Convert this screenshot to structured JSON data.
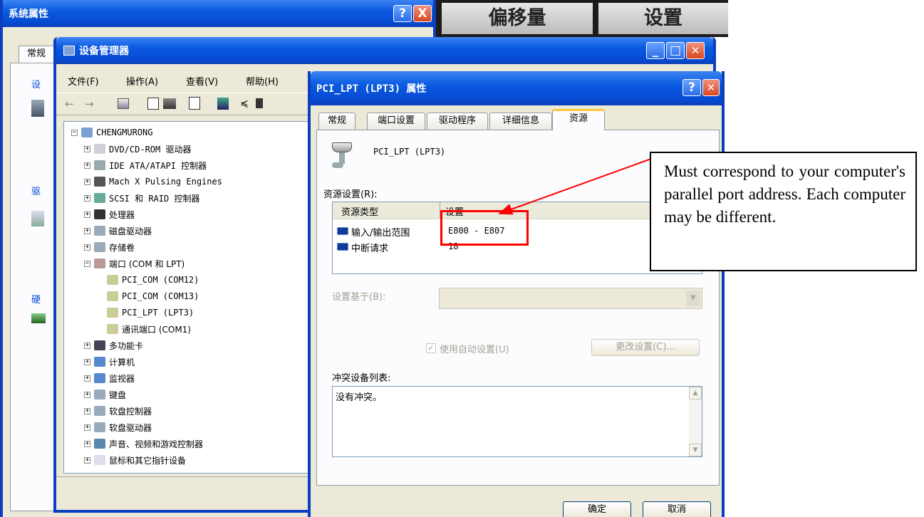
{
  "system_properties": {
    "title": "系统属性",
    "tab_general": "常规",
    "group_labels": [
      "设",
      "驱",
      "硬"
    ],
    "help_label": "?",
    "close_label": "X"
  },
  "banner": {
    "items": [
      "偏移量",
      "设置"
    ]
  },
  "device_manager": {
    "title": "设备管理器",
    "menu": [
      "文件(F)",
      "操作(A)",
      "查看(V)",
      "帮助(H)"
    ],
    "tree": [
      {
        "label": "CHENGMURONG",
        "expander": "−",
        "level": 0
      },
      {
        "label": "DVD/CD-ROM 驱动器",
        "expander": "+",
        "level": 1
      },
      {
        "label": "IDE ATA/ATAPI 控制器",
        "expander": "+",
        "level": 1
      },
      {
        "label": "Mach X Pulsing Engines",
        "expander": "+",
        "level": 1
      },
      {
        "label": "SCSI 和 RAID 控制器",
        "expander": "+",
        "level": 1
      },
      {
        "label": "处理器",
        "expander": "+",
        "level": 1
      },
      {
        "label": "磁盘驱动器",
        "expander": "+",
        "level": 1
      },
      {
        "label": "存储卷",
        "expander": "+",
        "level": 1
      },
      {
        "label": "端口 (COM 和 LPT)",
        "expander": "−",
        "level": 1
      },
      {
        "label": "PCI_COM (COM12)",
        "expander": "",
        "level": 2
      },
      {
        "label": "PCI_COM (COM13)",
        "expander": "",
        "level": 2
      },
      {
        "label": "PCI_LPT (LPT3)",
        "expander": "",
        "level": 2
      },
      {
        "label": "通讯端口 (COM1)",
        "expander": "",
        "level": 2
      },
      {
        "label": "多功能卡",
        "expander": "+",
        "level": 1
      },
      {
        "label": "计算机",
        "expander": "+",
        "level": 1
      },
      {
        "label": "监视器",
        "expander": "+",
        "level": 1
      },
      {
        "label": "键盘",
        "expander": "+",
        "level": 1
      },
      {
        "label": "软盘控制器",
        "expander": "+",
        "level": 1
      },
      {
        "label": "软盘驱动器",
        "expander": "+",
        "level": 1
      },
      {
        "label": "声音、视频和游戏控制器",
        "expander": "+",
        "level": 1
      },
      {
        "label": "鼠标和其它指针设备",
        "expander": "+",
        "level": 1
      }
    ]
  },
  "pci_properties": {
    "title": "PCI_LPT (LPT3) 属性",
    "tabs": [
      "常规",
      "端口设置",
      "驱动程序",
      "详细信息",
      "资源"
    ],
    "active_tab": "资源",
    "device_name": "PCI_LPT (LPT3)",
    "resource_settings_label": "资源设置(R):",
    "columns": [
      "资源类型",
      "设置"
    ],
    "rows": [
      {
        "type": "输入/输出范围",
        "setting": "E800 - E807"
      },
      {
        "type": "中断请求",
        "setting": "18"
      }
    ],
    "based_on_label": "设置基于(B):",
    "auto_settings_label": "使用自动设置(U)",
    "auto_checked": true,
    "change_settings_label": "更改设置(C)...",
    "conflict_label": "冲突设备列表:",
    "conflict_text": "没有冲突。",
    "ok_label": "确定",
    "cancel_label": "取消"
  },
  "annotation": {
    "text": "Must correspond to your computer's parallel port address. Each computer may be different.",
    "highlight_color": "#ff0000"
  }
}
